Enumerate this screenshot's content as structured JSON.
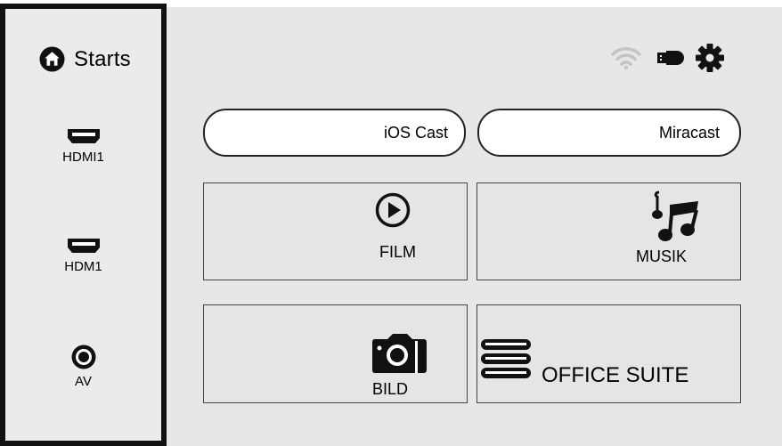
{
  "sidebar": {
    "home_label": "Starts",
    "items": [
      {
        "label": "HDMI1"
      },
      {
        "label": "HDM1"
      },
      {
        "label": "AV"
      }
    ]
  },
  "status": {
    "icons": [
      "wifi-icon",
      "usb-drive-icon",
      "settings-gear-icon"
    ]
  },
  "cast": {
    "ios_label": "iOS Cast",
    "miracast_label": "Miracast"
  },
  "tiles": {
    "film": "FILM",
    "musik": "MUSIK",
    "bild": "BILD",
    "office": "OFFICE SUITE"
  },
  "colors": {
    "background": "#e7e7e7",
    "sidebar_border": "#111111",
    "pill_fill": "#ffffff"
  }
}
